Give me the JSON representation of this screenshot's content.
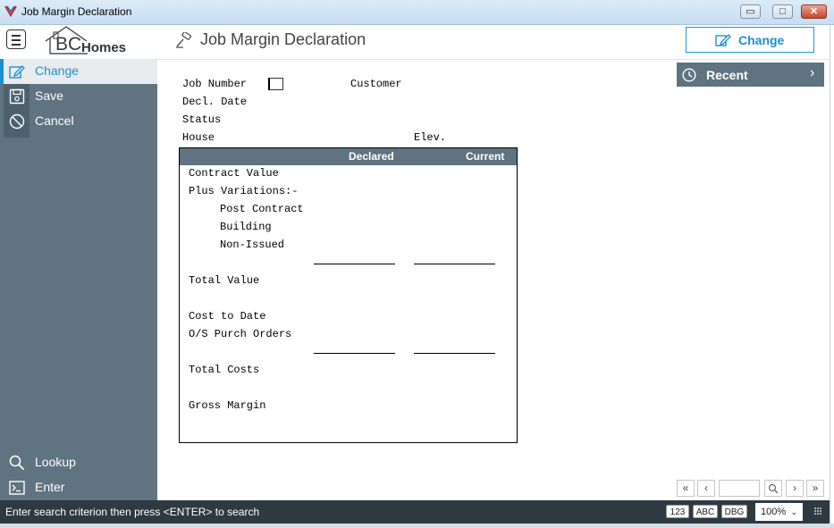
{
  "window": {
    "title": "Job Margin Declaration",
    "minimize": "▭",
    "maximize": "□",
    "close": "✕"
  },
  "header": {
    "logo_bc": "BC",
    "logo_homes": "Homes",
    "page_title": "Job Margin Declaration",
    "change_button": "Change"
  },
  "sidebar": {
    "items": [
      {
        "label": "Change",
        "icon": "edit-icon"
      },
      {
        "label": "Save",
        "icon": "save-icon"
      },
      {
        "label": "Cancel",
        "icon": "cancel-icon"
      }
    ],
    "bottom_items": [
      {
        "label": "Lookup",
        "icon": "search-icon"
      },
      {
        "label": "Enter",
        "icon": "terminal-icon"
      }
    ]
  },
  "form": {
    "job_number_label": "Job Number",
    "customer_label": "Customer",
    "decl_date_label": "Decl. Date",
    "status_label": "Status",
    "house_label": "House",
    "elev_label": "Elev.",
    "job_number_value": ""
  },
  "panel": {
    "col_declared": "Declared",
    "col_current": "Current",
    "rows": {
      "contract_value": "Contract Value",
      "plus_variations": "Plus Variations:-",
      "post_contract": "Post Contract",
      "building": "Building",
      "non_issued": "Non-Issued",
      "total_value": "Total Value",
      "cost_to_date": "Cost to Date",
      "os_purch_orders": "O/S Purch Orders",
      "total_costs": "Total Costs",
      "gross_margin": "Gross Margin"
    }
  },
  "recent": {
    "label": "Recent",
    "chevron": "›"
  },
  "pager": {
    "first": "«",
    "prev": "‹",
    "next": "›",
    "last": "»",
    "page_value": ""
  },
  "statusbar": {
    "message": "Enter search criterion then press <ENTER> to search",
    "badge_123": "123",
    "badge_abc": "ABC",
    "badge_dbg": "DBG",
    "zoom": "100%"
  },
  "colors": {
    "accent": "#1f8ed0",
    "sidebar": "#5f7381",
    "statusbar": "#2e3a42"
  }
}
